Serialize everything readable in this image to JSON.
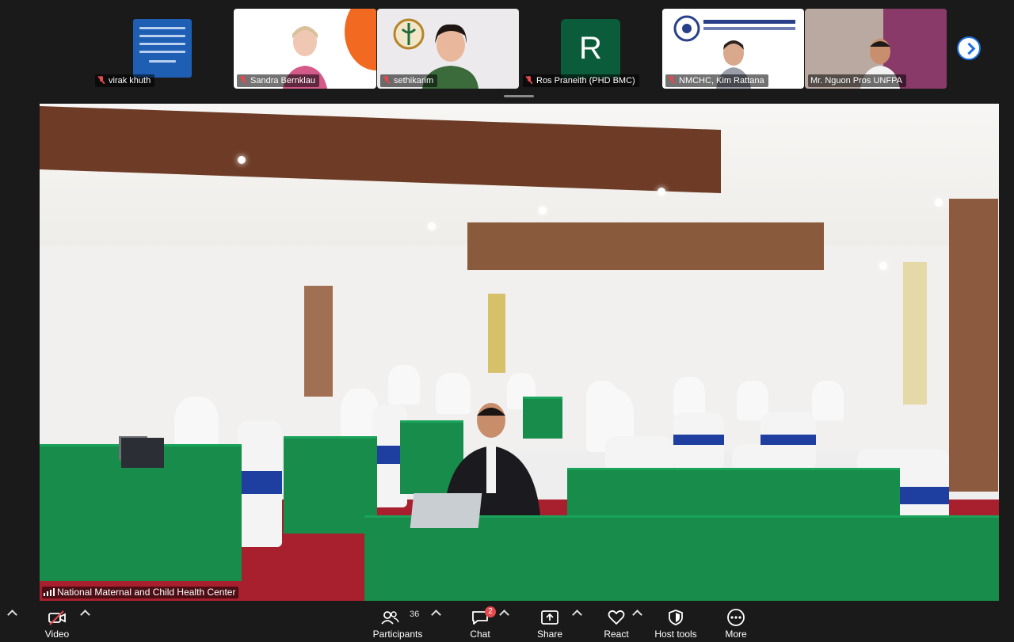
{
  "gallery": {
    "participants": [
      {
        "name": "virak khuth",
        "muted": true
      },
      {
        "name": "Sandra Bernklau",
        "muted": true
      },
      {
        "name": "sethikarim",
        "muted": true
      },
      {
        "name": "Ros Praneith (PHD BMC)",
        "muted": true,
        "avatar_letter": "R"
      },
      {
        "name": "NMCHC, Kim Rattana",
        "muted": true
      },
      {
        "name": "Mr. Nguon Pros UNFPA",
        "muted": false
      }
    ]
  },
  "main_video": {
    "label": "National Maternal and Child Health Center"
  },
  "toolbar": {
    "video_label": "Video",
    "participants_label": "Participants",
    "participants_count": "36",
    "chat_label": "Chat",
    "chat_badge": "2",
    "share_label": "Share",
    "react_label": "React",
    "host_tools_label": "Host tools",
    "more_label": "More"
  },
  "colors": {
    "background": "#1a1a1a",
    "muted_icon": "#e5484d",
    "accent_blue": "#1d6fe0",
    "avatar_green": "#0b5c3a",
    "tablecloth_green": "#178c4b",
    "carpet_red": "#a81f2d"
  },
  "icons": {
    "video": "video-off-icon",
    "participants": "people-icon",
    "chat": "chat-bubble-icon",
    "share": "share-arrow-icon",
    "react": "heart-icon",
    "host_tools": "shield-icon",
    "more": "ellipsis-icon",
    "next": "chevron-right-icon"
  }
}
